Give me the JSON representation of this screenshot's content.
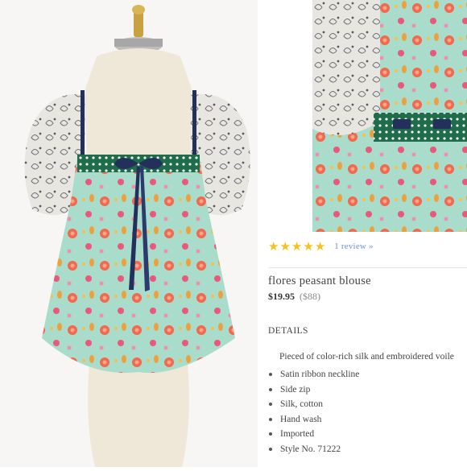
{
  "rating": {
    "stars": 5,
    "review_link": "1 review »",
    "star_color": "#f5c21b"
  },
  "product": {
    "name": "flores peasant blouse",
    "price": "$19.95",
    "original_price": "($88)"
  },
  "details": {
    "heading": "DETAILS",
    "description": "Pieced of color-rich silk and embroidered voile",
    "bullets": [
      "Satin ribbon neckline",
      "Side zip",
      "Silk, cotton",
      "Hand wash",
      "Imported",
      "Style No. 71222"
    ]
  },
  "colors": {
    "mint": "#a9dccb",
    "coral": "#ef6a4f",
    "navy": "#23305c",
    "green_band": "#1f6b4a",
    "link_blue": "#6e93c9"
  }
}
